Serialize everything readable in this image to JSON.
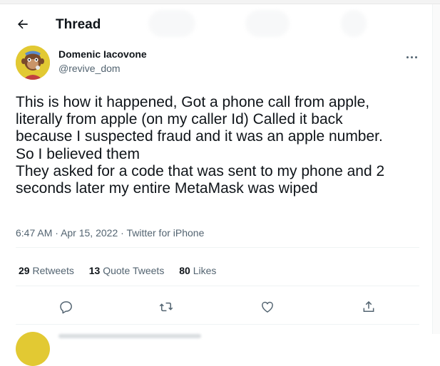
{
  "header": {
    "title": "Thread"
  },
  "tweet": {
    "author_name": "Domenic Iacovone",
    "author_handle": "@revive_dom",
    "text_lines": [
      "This is how it happened, Got a phone call from apple,",
      "literally from apple (on my caller Id) Called it back",
      "because I suspected fraud and it was an apple number.",
      "So I believed them",
      "They asked for a code that was sent to my phone and 2",
      "seconds later my entire MetaMask was wiped"
    ],
    "time": "6:47 AM",
    "date": "Apr 15, 2022",
    "source": "Twitter for iPhone",
    "separator": "·"
  },
  "stats": {
    "retweets_count": "29",
    "retweets_label": "Retweets",
    "quotes_count": "13",
    "quotes_label": "Quote Tweets",
    "likes_count": "80",
    "likes_label": "Likes"
  },
  "actions": [
    "reply-icon",
    "retweet-icon",
    "like-icon",
    "share-icon"
  ],
  "colors": {
    "text": "#0f1419",
    "secondary": "#536471",
    "border": "#eff3f4",
    "avatar_bg": "#e2c933"
  }
}
